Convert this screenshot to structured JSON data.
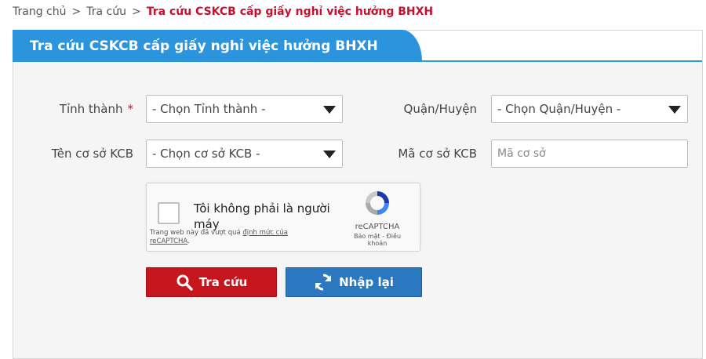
{
  "breadcrumb": {
    "home": "Trang chủ",
    "parent": "Tra cứu",
    "separator": ">",
    "current": "Tra cứu CSKCB cấp giấy nghỉ việc hưởng BHXH"
  },
  "panel": {
    "title": "Tra cứu CSKCB cấp giấy nghỉ việc hưởng BHXH"
  },
  "form": {
    "province": {
      "label": "Tỉnh thành",
      "required_mark": "*",
      "selected": "- Chọn Tỉnh thành -"
    },
    "district": {
      "label": "Quận/Huyện",
      "selected": "- Chọn Quận/Huyện -"
    },
    "facility": {
      "label": "Tên cơ sở KCB",
      "selected": "- Chọn cơ sở KCB -"
    },
    "facility_code": {
      "label": "Mã cơ sở KCB",
      "placeholder": "Mã cơ sở"
    }
  },
  "captcha": {
    "checkbox_label": "Tôi không phải là người máy",
    "note_prefix": "Trang web này đã vượt quá ",
    "note_link": "định mức của reCAPTCHA",
    "note_suffix": ".",
    "brand": "reCAPTCHA",
    "links": "Bảo mật - Điều khoản"
  },
  "buttons": {
    "search": "Tra cứu",
    "reset": "Nhập lại"
  },
  "colors": {
    "accent_blue": "#2c93dd",
    "danger_red": "#c4161c",
    "reset_blue": "#2b78c0",
    "breadcrumb_current": "#c8102e"
  },
  "icons": {
    "search": "search-icon",
    "reset": "refresh-icon",
    "captcha": "recaptcha-logo-icon",
    "dropdown": "caret-down-icon"
  }
}
